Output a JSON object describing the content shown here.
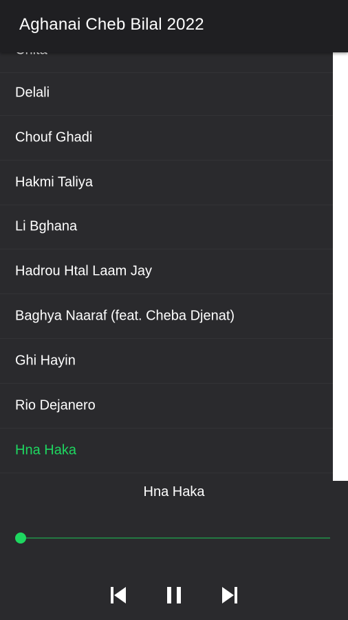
{
  "app_bar": {
    "title": "Aghanai Cheb Bilal 2022"
  },
  "playlist": {
    "items": [
      {
        "title": "Chita",
        "active": false
      },
      {
        "title": "Delali",
        "active": false
      },
      {
        "title": "Chouf Ghadi",
        "active": false
      },
      {
        "title": "Hakmi Taliya",
        "active": false
      },
      {
        "title": "Li Bghana",
        "active": false
      },
      {
        "title": "Hadrou Htal Laam Jay",
        "active": false
      },
      {
        "title": "Baghya Naaraf (feat. Cheba Djenat)",
        "active": false
      },
      {
        "title": "Ghi Hayin",
        "active": false
      },
      {
        "title": "Rio Dejanero",
        "active": false
      },
      {
        "title": "Hna Haka",
        "active": true
      }
    ]
  },
  "player": {
    "now_playing": "Hna Haka",
    "progress": 0.0,
    "controls": {
      "previous_icon": "skip-previous-icon",
      "play_pause_icon": "pause-icon",
      "next_icon": "skip-next-icon"
    }
  },
  "colors": {
    "background": "#2a2a2d",
    "app_bar": "#1f1f22",
    "accent": "#1ed760",
    "text": "#ffffff"
  }
}
